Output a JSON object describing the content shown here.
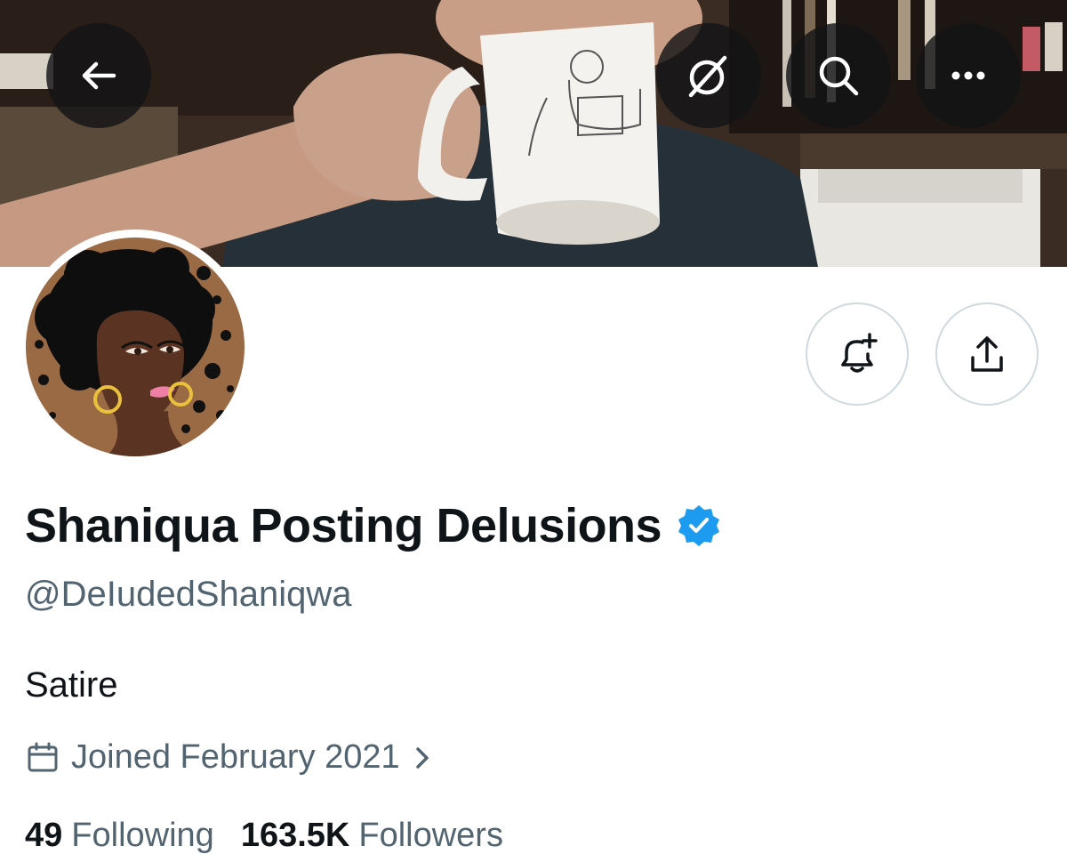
{
  "profile": {
    "display_name": "Shaniqua Posting Delusions",
    "handle": "@DeIudedShaniqwa",
    "bio": "Satire",
    "joined": "Joined February 2021",
    "verified": true
  },
  "stats": {
    "following_count": "49",
    "following_label": "Following",
    "followers_count": "163.5K",
    "followers_label": "Followers"
  },
  "icons": {
    "back": "arrow-left-icon",
    "grok": "grok-icon",
    "search": "search-icon",
    "more": "more-icon",
    "notify": "bell-plus-icon",
    "share": "share-icon",
    "verified": "verified-badge-icon",
    "calendar": "calendar-icon",
    "chevron": "chevron-right-icon"
  },
  "colors": {
    "text_primary": "#0f1419",
    "text_secondary": "#536471",
    "verified_blue": "#1d9bf0",
    "border": "#cfd9de"
  }
}
